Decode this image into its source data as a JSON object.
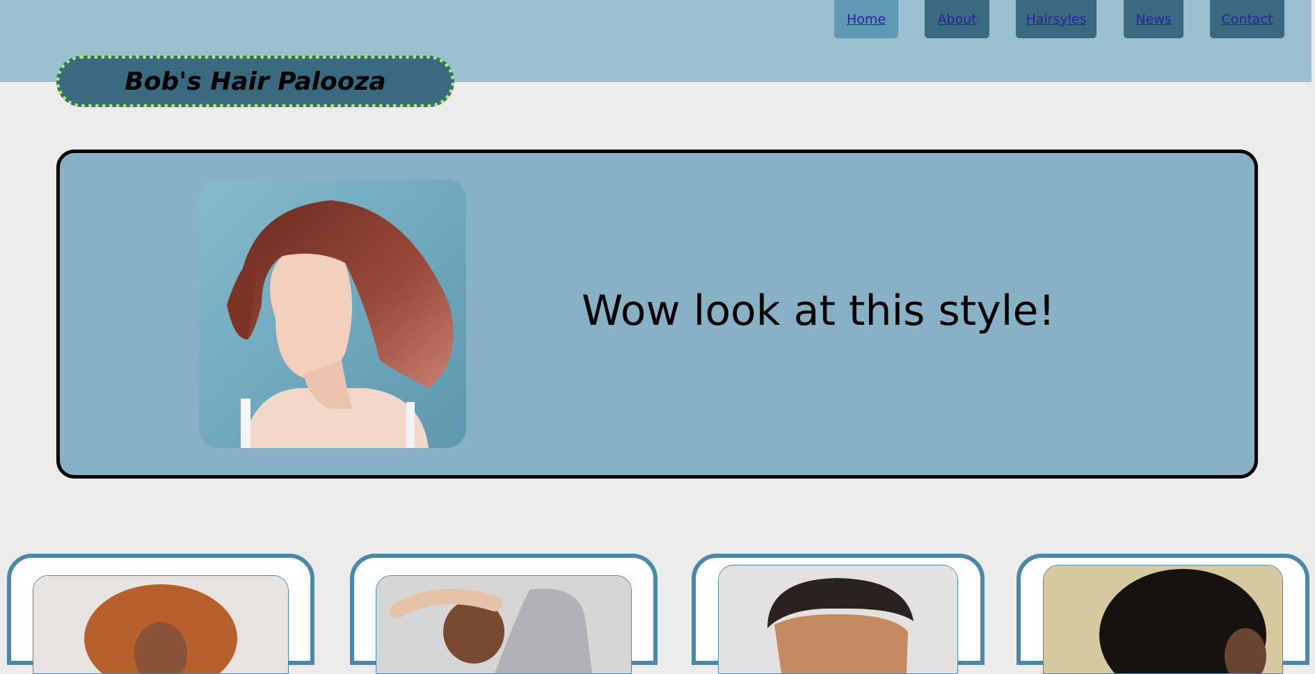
{
  "nav": {
    "items": [
      {
        "label": "Home",
        "active": true
      },
      {
        "label": "About",
        "active": false
      },
      {
        "label": "Hairsyles",
        "active": false
      },
      {
        "label": "News",
        "active": false
      },
      {
        "label": "Contact",
        "active": false
      }
    ]
  },
  "brand": {
    "title": "Bob's Hair Palooza"
  },
  "hero": {
    "caption": "Wow look at this style!"
  },
  "colors": {
    "header_bg": "#9ac0d0",
    "nav_bg": "#3a6a80",
    "nav_active_bg": "#5f9ab4",
    "link": "#2a1fa0",
    "logo_border": "#a6f25a",
    "hero_bg": "#89b1c6",
    "card_border": "#4a88a8",
    "page_bg": "#ececec"
  }
}
